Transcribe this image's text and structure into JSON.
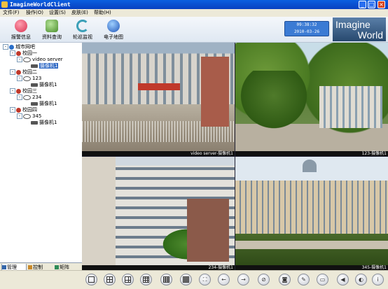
{
  "window": {
    "title": "ImagineWorldClient",
    "controls": {
      "minimize": "_",
      "maximize": "□",
      "close": "×"
    }
  },
  "menu": {
    "items": [
      {
        "label": "文件(F)"
      },
      {
        "label": "操作(O)"
      },
      {
        "label": "设置(S)"
      },
      {
        "label": "皮肤(E)"
      },
      {
        "label": "帮助(H)"
      }
    ]
  },
  "toolbar": {
    "buttons": [
      {
        "label": "报警信息",
        "icon": "heart-alarm-icon",
        "color": "#e2506a"
      },
      {
        "label": "资料查询",
        "icon": "person-search-icon",
        "color": "#5a9e3c"
      },
      {
        "label": "轮巡监视",
        "icon": "cycle-arrows-icon",
        "color": "#3ca0b8"
      },
      {
        "label": "电子地图",
        "icon": "globe-icon",
        "color": "#2a62c6"
      }
    ],
    "clock": {
      "time": "09:38:32",
      "date": "2010-03-26"
    },
    "brand": {
      "line1": "Imagine",
      "line2": "World"
    }
  },
  "tree": {
    "root": "城市网吧",
    "nodes": [
      {
        "label": "校园一",
        "level": 1,
        "type": "group"
      },
      {
        "label": "video server",
        "level": 2,
        "type": "server"
      },
      {
        "label": "摄像机1",
        "level": 3,
        "type": "camera",
        "selected": true
      },
      {
        "label": "校园二",
        "level": 1,
        "type": "group"
      },
      {
        "label": "123",
        "level": 2,
        "type": "server"
      },
      {
        "label": "摄像机1",
        "level": 3,
        "type": "camera"
      },
      {
        "label": "校园三",
        "level": 1,
        "type": "group"
      },
      {
        "label": "234",
        "level": 2,
        "type": "server"
      },
      {
        "label": "摄像机1",
        "level": 3,
        "type": "camera"
      },
      {
        "label": "校园四",
        "level": 1,
        "type": "group"
      },
      {
        "label": "345",
        "level": 2,
        "type": "server"
      },
      {
        "label": "摄像机1",
        "level": 3,
        "type": "camera"
      }
    ]
  },
  "tabs": [
    {
      "label": "管理",
      "active": true
    },
    {
      "label": "控制",
      "active": false
    },
    {
      "label": "矩阵",
      "active": false
    }
  ],
  "videos": [
    {
      "caption": "video server-摄像机1",
      "active": true
    },
    {
      "caption": "123-摄像机1",
      "active": false
    },
    {
      "caption": "234-摄像机1",
      "active": false
    },
    {
      "caption": "345-摄像机1",
      "active": false
    }
  ],
  "controls": {
    "buttons": [
      {
        "name": "layout-1-button",
        "icon": "single-view-icon",
        "glyph": ""
      },
      {
        "name": "layout-4-button",
        "icon": "quad-view-icon",
        "glyph": ""
      },
      {
        "name": "layout-6-button",
        "icon": "six-view-icon",
        "glyph": ""
      },
      {
        "name": "layout-9-button",
        "icon": "nine-view-icon",
        "glyph": ""
      },
      {
        "name": "layout-12-button",
        "icon": "twelve-view-icon",
        "glyph": ""
      },
      {
        "name": "layout-16-button",
        "icon": "sixteen-view-icon",
        "glyph": ""
      },
      {
        "name": "fullscreen-button",
        "icon": "fullscreen-icon",
        "glyph": "⛶"
      },
      {
        "name": "prev-page-button",
        "icon": "arrow-left-icon",
        "glyph": "←"
      },
      {
        "name": "next-page-button",
        "icon": "arrow-right-icon",
        "glyph": "→"
      },
      {
        "name": "stop-button",
        "icon": "no-entry-icon",
        "glyph": "⊘"
      },
      {
        "name": "snapshot-button",
        "icon": "camera-icon",
        "glyph": "◙"
      },
      {
        "name": "record-button",
        "icon": "record-icon",
        "glyph": "✎"
      },
      {
        "name": "playback-button",
        "icon": "playback-icon",
        "glyph": "▭"
      },
      {
        "name": "volume-button",
        "icon": "speaker-icon",
        "glyph": "◀"
      },
      {
        "name": "talk-button",
        "icon": "intercom-icon",
        "glyph": "◐"
      },
      {
        "name": "info-button",
        "icon": "info-icon",
        "glyph": "i"
      }
    ]
  }
}
